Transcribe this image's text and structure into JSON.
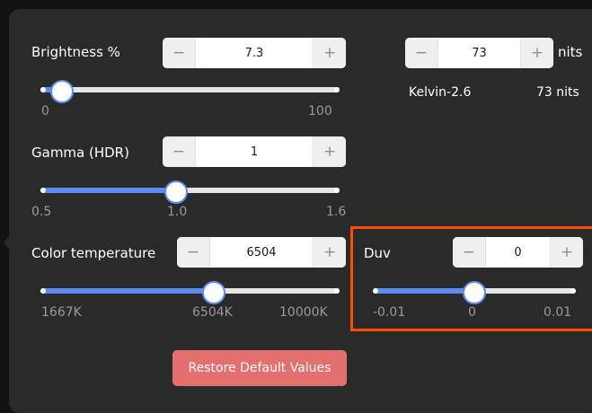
{
  "brightness": {
    "label": "Brightness %",
    "value": "7.3",
    "minus": "−",
    "plus": "+",
    "min_label": "0",
    "max_label": "100",
    "level": 0.073
  },
  "nits": {
    "value": "73",
    "minus": "−",
    "plus": "+",
    "unit": "nits",
    "kelvin": "Kelvin-2.6",
    "nits_readout": "73 nits"
  },
  "gamma": {
    "label": "Gamma (HDR)",
    "value": "1",
    "minus": "−",
    "plus": "+",
    "min_label": "0.5",
    "mid_label": "1.0",
    "max_label": "1.6",
    "level": 0.4545
  },
  "color_temperature": {
    "label": "Color temperature",
    "value": "6504",
    "minus": "−",
    "plus": "+",
    "min_label": "1667K",
    "mid_label": "6504K",
    "max_label": "10000K",
    "level": 0.5804
  },
  "duv": {
    "label": "Duv",
    "value": "0",
    "minus": "−",
    "plus": "+",
    "min_label": "-0.01",
    "mid_label": "0",
    "max_label": "0.01",
    "level": 0.5
  },
  "restore_button": "Restore Default Values",
  "colors": {
    "panel": "#2a2a2a",
    "accent": "#5b8df0",
    "highlight": "#ff4d00",
    "restore": "#e46f6f"
  }
}
